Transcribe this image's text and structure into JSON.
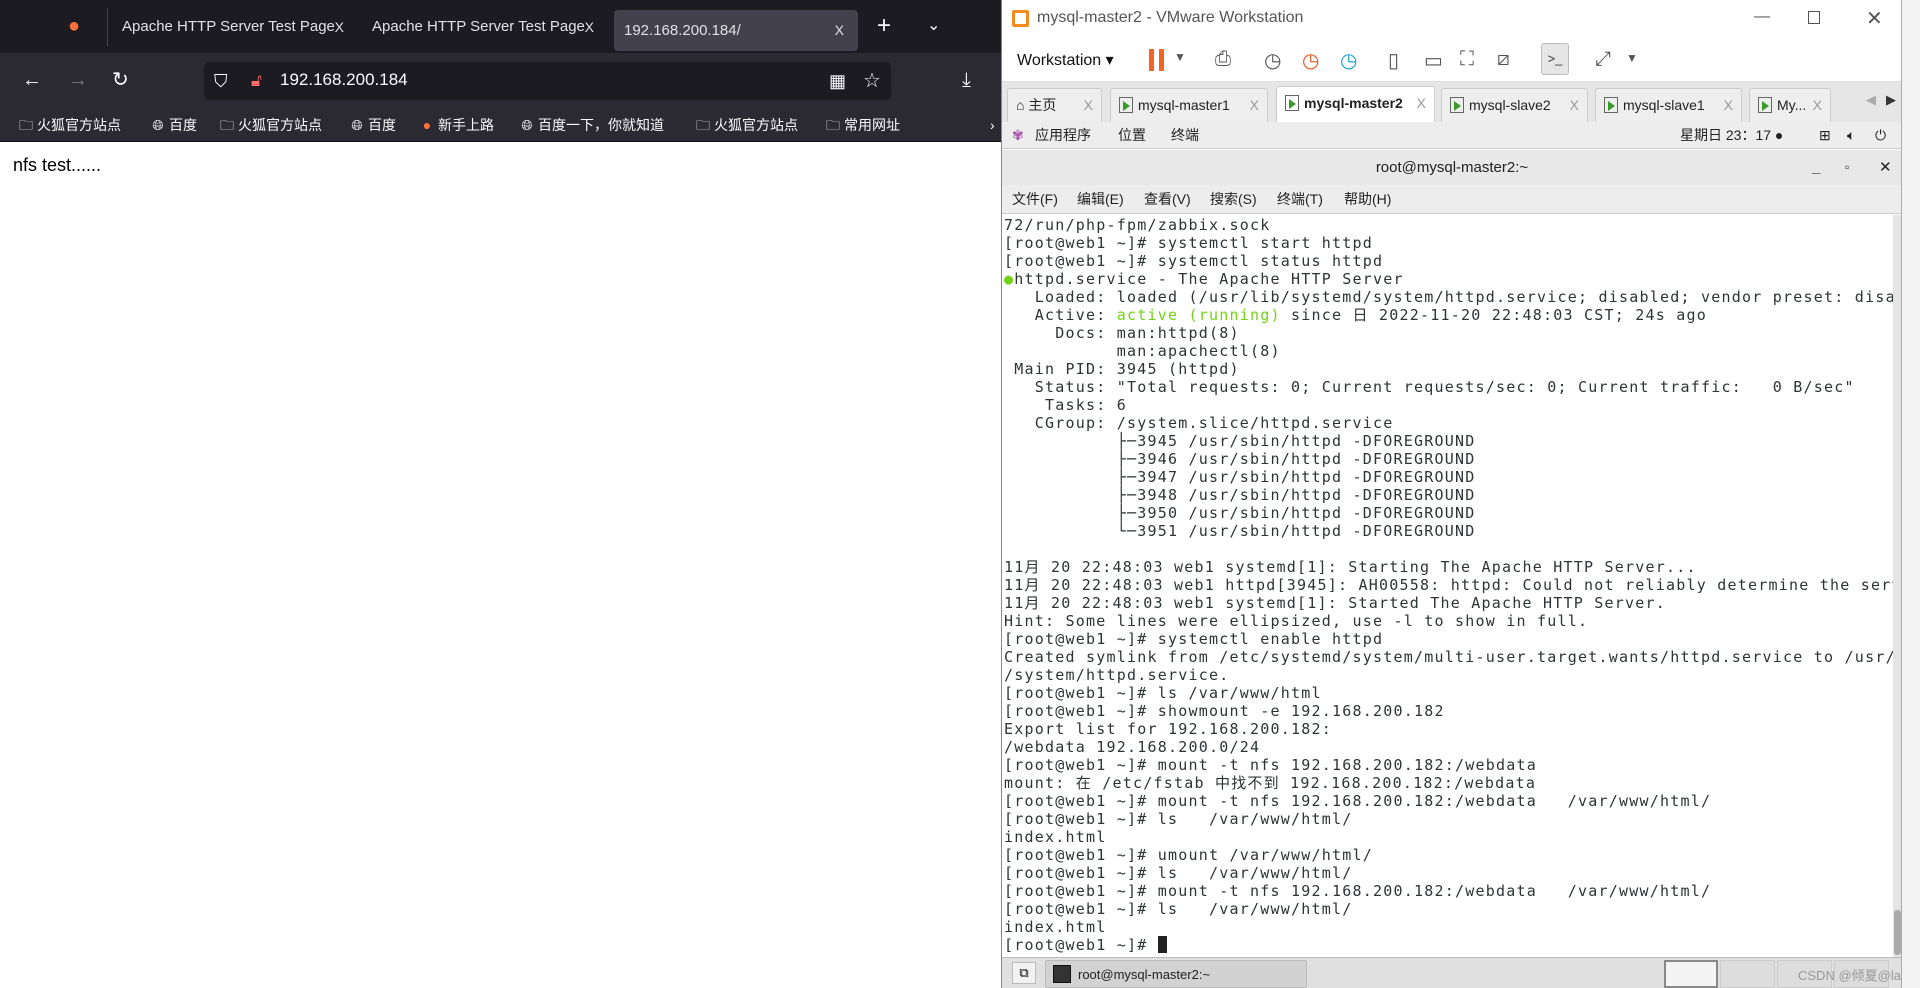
{
  "browser": {
    "tabs": [
      {
        "label": "Apache HTTP Server Test Page"
      },
      {
        "label": "Apache HTTP Server Test Page"
      },
      {
        "label": "192.168.200.184/"
      }
    ],
    "url": "192.168.200.184",
    "bookmarks": [
      {
        "label": "火狐官方站点",
        "icon": "folder-icon"
      },
      {
        "label": "百度",
        "icon": "globe-icon"
      },
      {
        "label": "火狐官方站点",
        "icon": "folder-icon"
      },
      {
        "label": "百度",
        "icon": "globe-icon"
      },
      {
        "label": "新手上路",
        "icon": "firefox-icon"
      },
      {
        "label": "百度一下，你就知道",
        "icon": "globe-icon"
      },
      {
        "label": "火狐官方站点",
        "icon": "folder-icon"
      },
      {
        "label": "常用网址",
        "icon": "folder-icon"
      }
    ],
    "page_text": "nfs test......",
    "tab_close": "X",
    "new_tab": "+"
  },
  "vmware": {
    "title": "mysql-master2 - VMware Workstation",
    "menu_label": "Workstation",
    "tabs": [
      {
        "label": "主页"
      },
      {
        "label": "mysql-master1"
      },
      {
        "label": "mysql-master2"
      },
      {
        "label": "mysql-slave2"
      },
      {
        "label": "mysql-slave1"
      },
      {
        "label": "My..."
      }
    ],
    "tab_close": "X"
  },
  "gnome": {
    "apps": "应用程序",
    "places": "位置",
    "terminal": "终端",
    "clock": "星期日 23：17 ●"
  },
  "terminal": {
    "title": "root@mysql-master2:~",
    "menu": [
      "文件(F)",
      "编辑(E)",
      "查看(V)",
      "搜索(S)",
      "终端(T)",
      "帮助(H)"
    ],
    "lines": [
      "72/run/php-fpm/zabbix.sock",
      "[root@web1 ~]# systemctl start httpd",
      "[root@web1 ~]# systemctl status httpd",
      "httpd.service - The Apache HTTP Server",
      "   Loaded: loaded (/usr/lib/systemd/system/httpd.service; disabled; vendor preset: disabled)",
      "   Active: ",
      "     Docs: man:httpd(8)",
      "           man:apachectl(8)",
      " Main PID: 3945 (httpd)",
      "   Status: \"Total requests: 0; Current requests/sec: 0; Current traffic:   0 B/sec\"",
      "    Tasks: 6",
      "   CGroup: /system.slice/httpd.service",
      "           ├─3945 /usr/sbin/httpd -DFOREGROUND",
      "           ├─3946 /usr/sbin/httpd -DFOREGROUND",
      "           ├─3947 /usr/sbin/httpd -DFOREGROUND",
      "           ├─3948 /usr/sbin/httpd -DFOREGROUND",
      "           ├─3950 /usr/sbin/httpd -DFOREGROUND",
      "           └─3951 /usr/sbin/httpd -DFOREGROUND",
      "",
      "11月 20 22:48:03 web1 systemd[1]: Starting The Apache HTTP Server...",
      "11月 20 22:48:03 web1 httpd[3945]: AH00558: httpd: Could not reliably determine the server...sage",
      "11月 20 22:48:03 web1 systemd[1]: Started The Apache HTTP Server.",
      "Hint: Some lines were ellipsized, use -l to show in full.",
      "[root@web1 ~]# systemctl enable httpd",
      "Created symlink from /etc/systemd/system/multi-user.target.wants/httpd.service to /usr/lib/systemd",
      "/system/httpd.service.",
      "[root@web1 ~]# ls /var/www/html",
      "[root@web1 ~]# showmount -e 192.168.200.182",
      "Export list for 192.168.200.182:",
      "/webdata 192.168.200.0/24",
      "[root@web1 ~]# mount -t nfs 192.168.200.182:/webdata",
      "mount: 在 /etc/fstab 中找不到 192.168.200.182:/webdata",
      "[root@web1 ~]# mount -t nfs 192.168.200.182:/webdata   /var/www/html/",
      "[root@web1 ~]# ls   /var/www/html/",
      "index.html",
      "[root@web1 ~]# umount /var/www/html/",
      "[root@web1 ~]# ls   /var/www/html/",
      "[root@web1 ~]# mount -t nfs 192.168.200.182:/webdata   /var/www/html/",
      "[root@web1 ~]# ls   /var/www/html/",
      "index.html",
      "[root@web1 ~]# "
    ],
    "active_status": "active (running)",
    "active_rest": " since 日 2022-11-20 22:48:03 CST; 24s ago",
    "status_color": "#73d216"
  },
  "taskbar": {
    "task_label": "root@mysql-master2:~",
    "watermark": "CSDN @倾夏@la"
  }
}
